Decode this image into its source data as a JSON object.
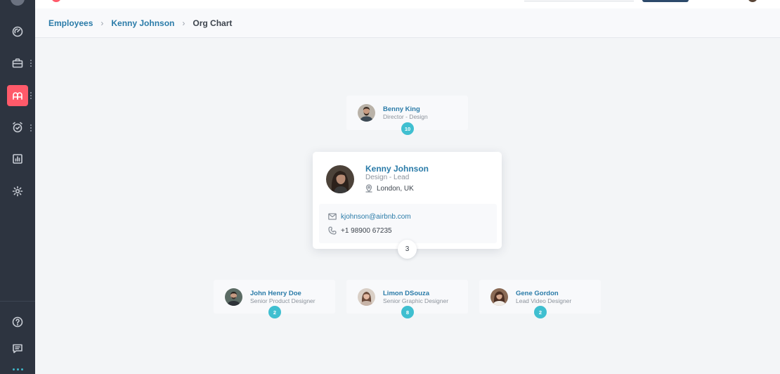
{
  "breadcrumb": {
    "items": [
      "Employees",
      "Kenny Johnson"
    ],
    "separator": "›",
    "current": "Org Chart"
  },
  "sidebar": {
    "items": [
      {
        "icon": "gauge-icon"
      },
      {
        "icon": "briefcase-icon"
      },
      {
        "icon": "users-icon",
        "active": true
      },
      {
        "icon": "alarm-clock-icon"
      },
      {
        "icon": "bar-chart-icon"
      },
      {
        "icon": "gear-icon"
      }
    ],
    "footer": [
      {
        "icon": "help-icon"
      },
      {
        "icon": "message-icon"
      }
    ]
  },
  "manager": {
    "name": "Benny King",
    "role": "Director - Design",
    "reports_count": "10"
  },
  "employee": {
    "name": "Kenny Johnson",
    "role": "Design - Lead",
    "location": "London, UK",
    "email": "kjohnson@airbnb.com",
    "phone": "+1 98900 67235",
    "reports_count": "3"
  },
  "reports": [
    {
      "name": "John Henry Doe",
      "role": "Senior Product Designer",
      "reports_count": "2"
    },
    {
      "name": "Limon DSouza",
      "role": "Senior Graphic Designer",
      "reports_count": "8"
    },
    {
      "name": "Gene Gordon",
      "role": "Lead Video Designer",
      "reports_count": "2"
    }
  ],
  "colors": {
    "sidebar_bg": "#2d3440",
    "accent_red": "#ff5a6a",
    "link_blue": "#2a7ba8",
    "badge_teal": "#3fbfd0"
  }
}
